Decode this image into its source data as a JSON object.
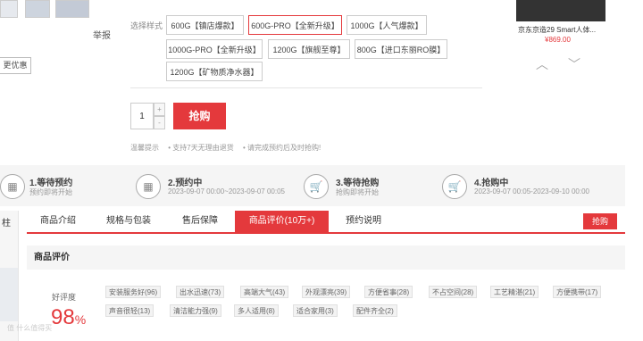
{
  "gallery": {
    "report": "举报",
    "more": "更优惠"
  },
  "style": {
    "label": "选择样式",
    "options": [
      "600G【镇店爆款】",
      "600G-PRO【全新升级】",
      "1000G【人气爆款】",
      "1000G-PRO【全新升级】",
      "1200G【旗舰至尊】",
      "800G【进口东丽RO膜】",
      "1200G【矿物质净水器】"
    ],
    "selected_index": 1
  },
  "purchase": {
    "quantity": "1",
    "plus": "+",
    "minus": "-",
    "buy_label": "抢购"
  },
  "tips": {
    "label": "温馨提示",
    "items": [
      "支持7天无理由退货",
      "请完成预约后及时抢购!"
    ]
  },
  "steps": [
    {
      "title": "1.等待预约",
      "sub": "预约即将开始",
      "icon": "calendar-icon"
    },
    {
      "title": "2.预约中",
      "sub": "2023-09-07 00:00~2023-09-07 00:05",
      "icon": "calendar-icon"
    },
    {
      "title": "3.等待抢购",
      "sub": "抢购即将开始",
      "icon": "cart-icon"
    },
    {
      "title": "4.抢购中",
      "sub": "2023-09-07 00:05-2023-09-10 00:00",
      "icon": "cart-icon"
    }
  ],
  "tabs": {
    "left_fragment": "柱",
    "items": [
      "商品介绍",
      "规格与包装",
      "售后保障",
      "商品评价(10万+)",
      "预约说明"
    ],
    "active_index": 3,
    "buy_label": "抢购"
  },
  "reviews": {
    "heading": "商品评价",
    "rate_label": "好评度",
    "rate_value": "98",
    "rate_unit": "%",
    "tags": [
      "安装服务好(96)",
      "出水迅速(73)",
      "高端大气(43)",
      "外观漂亮(39)",
      "方便省事(28)",
      "不占空间(28)",
      "工艺精湛(21)",
      "方便携带(17)",
      "声音很轻(13)",
      "清洁能力强(9)",
      "多人适用(8)",
      "适合家用(3)",
      "配件齐全(2)"
    ],
    "watermark": "值 什么值得买"
  },
  "recommend": {
    "name": "京东京造29 Smart人体...",
    "price": "¥869.00"
  },
  "colors": {
    "accent": "#e4393c"
  }
}
